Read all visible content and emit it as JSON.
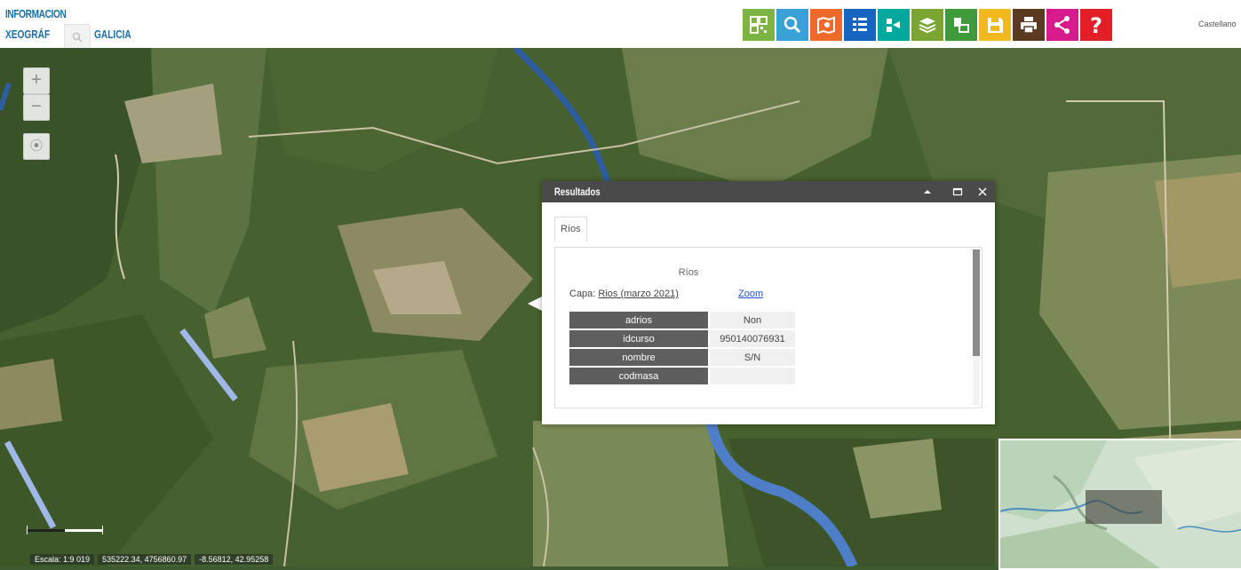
{
  "header": {
    "logo_line1": "INFORMACION",
    "logo_line2": "XEOGRÁF",
    "logo_line3": "GALICIA",
    "language": "Castellano"
  },
  "toolbar": {
    "buttons": [
      {
        "icon": "qr-code-icon",
        "color": "#7cb342"
      },
      {
        "icon": "search-icon",
        "color": "#3aa0d8"
      },
      {
        "icon": "map-search-icon",
        "color": "#ee6a2c"
      },
      {
        "icon": "list-icon",
        "color": "#1565c0"
      },
      {
        "icon": "hierarchy-icon",
        "color": "#00a89d"
      },
      {
        "icon": "layers-icon",
        "color": "#7aa532"
      },
      {
        "icon": "map-tool-icon",
        "color": "#3f9a3a"
      },
      {
        "icon": "save-icon",
        "color": "#f2b820"
      },
      {
        "icon": "print-icon",
        "color": "#5a3a20"
      },
      {
        "icon": "share-icon",
        "color": "#d81b8c"
      },
      {
        "icon": "help-icon",
        "color": "#e21f26"
      }
    ]
  },
  "map_controls": {
    "zoom_in": "+",
    "zoom_out": "−",
    "locate": "⦿"
  },
  "panel": {
    "title": "Resultados",
    "tab": "Ríos",
    "body_title": "Ríos",
    "capa_label": "Capa:",
    "capa_value": "Rios (marzo 2021)",
    "zoom_label": "Zoom",
    "rows": [
      {
        "key": "adrios",
        "value": "Non"
      },
      {
        "key": "idcurso",
        "value": "950140076931"
      },
      {
        "key": "nombre",
        "value": "S/N"
      },
      {
        "key": "codmasa",
        "value": ""
      }
    ]
  },
  "footer": {
    "scale": "Escala: 1:9 019",
    "coords": "535222.34, 4756860.97",
    "latlon": "-8.56812, 42.95258"
  }
}
